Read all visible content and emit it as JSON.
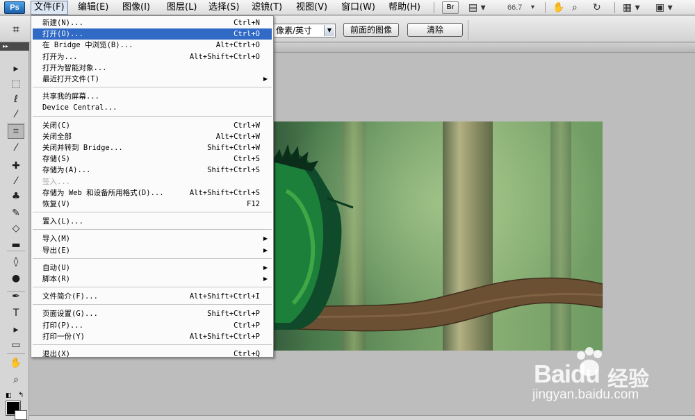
{
  "menubar": {
    "logo": "Ps",
    "items": [
      {
        "label": "文件(F)",
        "active": true
      },
      {
        "label": "编辑(E)"
      },
      {
        "label": "图像(I)"
      },
      {
        "label": "图层(L)"
      },
      {
        "label": "选择(S)"
      },
      {
        "label": "滤镜(T)"
      },
      {
        "label": "视图(V)"
      },
      {
        "label": "窗口(W)"
      },
      {
        "label": "帮助(H)"
      }
    ],
    "bridge_button": "Br",
    "zoom": "66.7"
  },
  "options": {
    "resolution_unit": "像素/英寸",
    "front_image_button": "前面的图像",
    "clear_button": "清除"
  },
  "file_menu": {
    "groups": [
      [
        {
          "label": "新建(N)...",
          "shortcut": "Ctrl+N"
        },
        {
          "label": "打开(O)...",
          "shortcut": "Ctrl+O",
          "highlighted": true
        },
        {
          "label": "在 Bridge 中浏览(B)...",
          "shortcut": "Alt+Ctrl+O"
        },
        {
          "label": "打开为...",
          "shortcut": "Alt+Shift+Ctrl+O"
        },
        {
          "label": "打开为智能对象..."
        },
        {
          "label": "最近打开文件(T)",
          "submenu": true
        }
      ],
      [
        {
          "label": "共享我的屏幕..."
        },
        {
          "label": "Device Central..."
        }
      ],
      [
        {
          "label": "关闭(C)",
          "shortcut": "Ctrl+W"
        },
        {
          "label": "关闭全部",
          "shortcut": "Alt+Ctrl+W"
        },
        {
          "label": "关闭并转到 Bridge...",
          "shortcut": "Shift+Ctrl+W"
        },
        {
          "label": "存储(S)",
          "shortcut": "Ctrl+S"
        },
        {
          "label": "存储为(A)...",
          "shortcut": "Shift+Ctrl+S"
        },
        {
          "label": "签入...",
          "disabled": true
        },
        {
          "label": "存储为 Web 和设备所用格式(D)...",
          "shortcut": "Alt+Shift+Ctrl+S"
        },
        {
          "label": "恢复(V)",
          "shortcut": "F12"
        }
      ],
      [
        {
          "label": "置入(L)..."
        }
      ],
      [
        {
          "label": "导入(M)",
          "submenu": true
        },
        {
          "label": "导出(E)",
          "submenu": true
        }
      ],
      [
        {
          "label": "自动(U)",
          "submenu": true
        },
        {
          "label": "脚本(R)",
          "submenu": true
        }
      ],
      [
        {
          "label": "文件简介(F)...",
          "shortcut": "Alt+Shift+Ctrl+I"
        }
      ],
      [
        {
          "label": "页面设置(G)...",
          "shortcut": "Shift+Ctrl+P"
        },
        {
          "label": "打印(P)...",
          "shortcut": "Ctrl+P"
        },
        {
          "label": "打印一份(Y)",
          "shortcut": "Alt+Shift+Ctrl+P"
        }
      ],
      [
        {
          "label": "退出(X)",
          "shortcut": "Ctrl+Q"
        }
      ]
    ]
  },
  "tools": [
    {
      "icon": "move-tool-icon",
      "glyph": "▸"
    },
    {
      "icon": "marquee-tool-icon",
      "glyph": "⬚"
    },
    {
      "icon": "lasso-tool-icon",
      "glyph": "ℓ"
    },
    {
      "icon": "magic-wand-tool-icon",
      "glyph": "⁄"
    },
    {
      "icon": "crop-tool-icon",
      "glyph": "⌗",
      "selected": true
    },
    {
      "icon": "eyedropper-tool-icon",
      "glyph": "⁄"
    },
    {
      "icon": "healing-brush-tool-icon",
      "glyph": "✚"
    },
    {
      "icon": "brush-tool-icon",
      "glyph": "⁄"
    },
    {
      "icon": "clone-stamp-tool-icon",
      "glyph": "♣"
    },
    {
      "icon": "history-brush-tool-icon",
      "glyph": "✎"
    },
    {
      "icon": "eraser-tool-icon",
      "glyph": "◇"
    },
    {
      "icon": "gradient-tool-icon",
      "glyph": "▬"
    },
    {
      "icon": "blur-tool-icon",
      "glyph": "◊"
    },
    {
      "icon": "dodge-tool-icon",
      "glyph": "●"
    },
    {
      "icon": "pen-tool-icon",
      "glyph": "✒"
    },
    {
      "icon": "type-tool-icon",
      "glyph": "T"
    },
    {
      "icon": "path-selection-tool-icon",
      "glyph": "▸"
    },
    {
      "icon": "shape-tool-icon",
      "glyph": "▭"
    },
    {
      "icon": "hand-tool-icon",
      "glyph": "✋"
    },
    {
      "icon": "zoom-tool-icon",
      "glyph": "⌕"
    }
  ],
  "watermark": {
    "logo": "Baidu",
    "logo_cn": "经验",
    "url": "jingyan.baidu.com"
  },
  "colors": {
    "menu_highlight": "#316ac5",
    "foreground": "#000000",
    "background": "#ffffff"
  }
}
